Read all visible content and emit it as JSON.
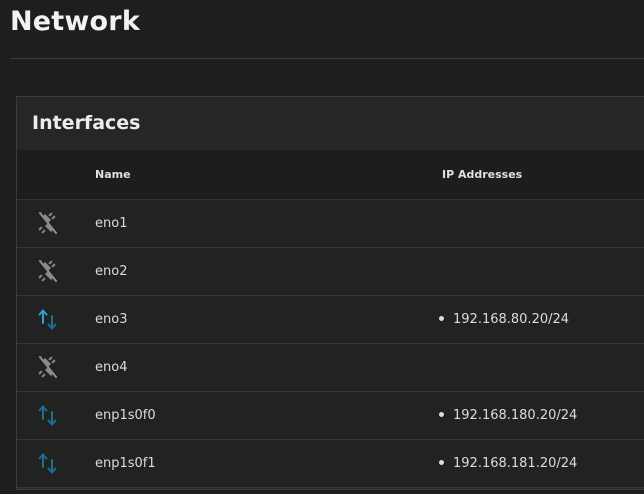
{
  "page": {
    "title": "Network"
  },
  "card": {
    "title": "Interfaces"
  },
  "table": {
    "columns": {
      "name": "Name",
      "ip": "IP Addresses"
    },
    "rows": [
      {
        "name": "eno1",
        "ip": "",
        "status": "disconnected"
      },
      {
        "name": "eno2",
        "ip": "",
        "status": "disconnected"
      },
      {
        "name": "eno3",
        "ip": "192.168.80.20/24",
        "status": "active"
      },
      {
        "name": "eno4",
        "ip": "",
        "status": "disconnected"
      },
      {
        "name": "enp1s0f0",
        "ip": "192.168.180.20/24",
        "status": "up"
      },
      {
        "name": "enp1s0f1",
        "ip": "192.168.181.20/24",
        "status": "up"
      }
    ]
  },
  "colors": {
    "active": "#2aa4d6",
    "up": "#1d6f8c",
    "disconnected": "#8a8a8a"
  },
  "icons": {
    "disconnected": "lan-disconnect-icon",
    "up": "transfer-arrows-icon"
  }
}
